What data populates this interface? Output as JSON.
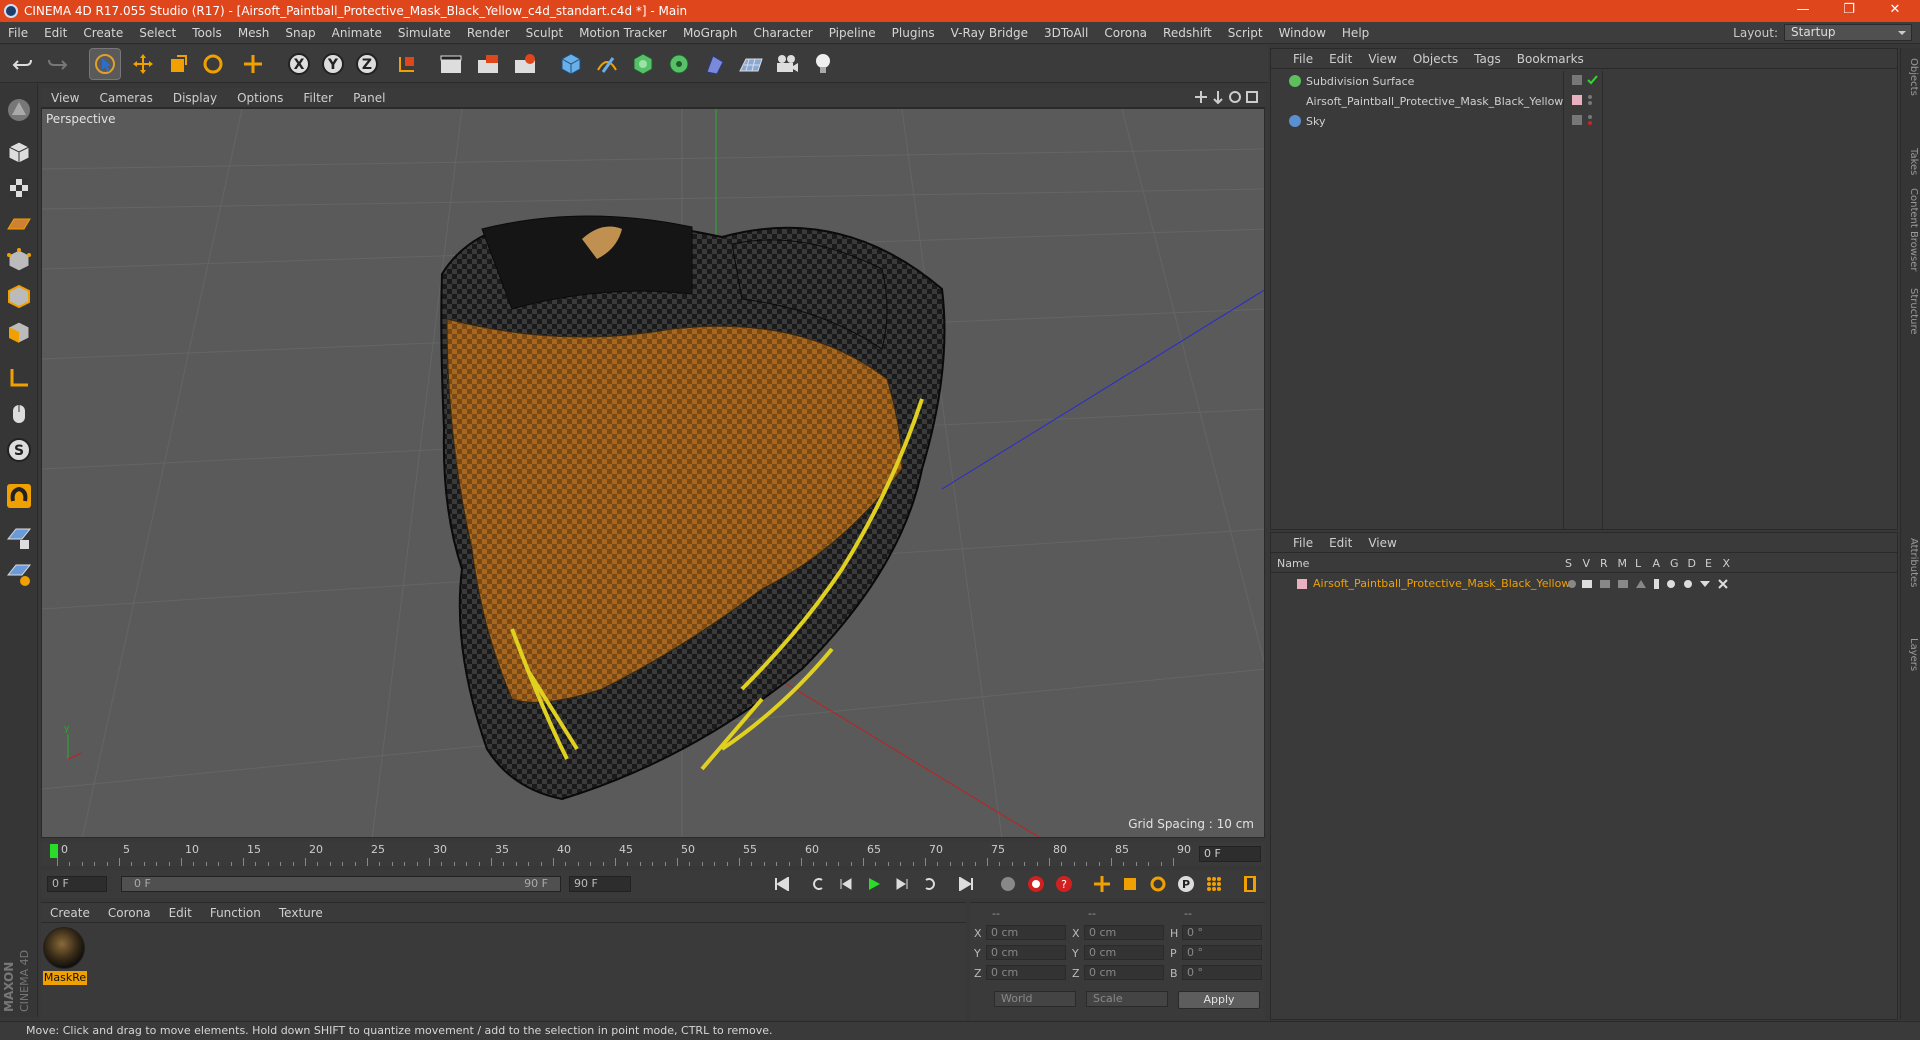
{
  "window": {
    "title": "CINEMA 4D R17.055 Studio (R17) - [Airsoft_Paintball_Protective_Mask_Black_Yellow_c4d_standart.c4d *] - Main",
    "controls": [
      "—",
      "❐",
      "✕"
    ]
  },
  "menubar": {
    "items": [
      "File",
      "Edit",
      "Create",
      "Select",
      "Tools",
      "Mesh",
      "Snap",
      "Animate",
      "Simulate",
      "Render",
      "Sculpt",
      "Motion Tracker",
      "MoGraph",
      "Character",
      "Pipeline",
      "Plugins",
      "V-Ray Bridge",
      "3DToAll",
      "Corona",
      "Redshift",
      "Script",
      "Window",
      "Help"
    ],
    "layout_label": "Layout:",
    "layout_value": "Startup"
  },
  "viewport": {
    "menu": [
      "View",
      "Cameras",
      "Display",
      "Options",
      "Filter",
      "Panel"
    ],
    "label": "Perspective",
    "grid_spacing": "Grid Spacing : 10 cm"
  },
  "timeline": {
    "ticks": [
      "0",
      "5",
      "10",
      "15",
      "20",
      "25",
      "30",
      "35",
      "40",
      "45",
      "50",
      "55",
      "60",
      "65",
      "70",
      "75",
      "80",
      "85",
      "90"
    ],
    "current_frame": "0 F"
  },
  "transport": {
    "start": "0 F",
    "range_start": "0 F",
    "range_end": "90 F",
    "end": "90 F"
  },
  "material_manager": {
    "menu": [
      "Create",
      "Corona",
      "Edit",
      "Function",
      "Texture"
    ],
    "material_name": "MaskRe"
  },
  "coordinates": {
    "headers": [
      "--",
      "--",
      "--"
    ],
    "rows": [
      {
        "a": "X",
        "av": "0 cm",
        "b": "X",
        "bv": "0 cm",
        "c": "H",
        "cv": "0 °"
      },
      {
        "a": "Y",
        "av": "0 cm",
        "b": "Y",
        "bv": "0 cm",
        "c": "P",
        "cv": "0 °"
      },
      {
        "a": "Z",
        "av": "0 cm",
        "b": "Z",
        "bv": "0 cm",
        "c": "B",
        "cv": "0 °"
      }
    ],
    "mode1": "World",
    "mode2": "Scale",
    "apply": "Apply"
  },
  "object_manager": {
    "menu": [
      "File",
      "Edit",
      "View",
      "Objects",
      "Tags",
      "Bookmarks"
    ],
    "objects": [
      {
        "name": "Subdivision Surface",
        "color": "#5fbf5f"
      },
      {
        "name": "Airsoft_Paintball_Protective_Mask_Black_Yellow",
        "color": "#b0b0b0"
      },
      {
        "name": "Sky",
        "color": "#5a8fd0"
      }
    ]
  },
  "layer_manager": {
    "menu": [
      "File",
      "Edit",
      "View"
    ],
    "col_name": "Name",
    "col_flags": [
      "S",
      "V",
      "R",
      "M",
      "L",
      "A",
      "G",
      "D",
      "E",
      "X"
    ],
    "layer_name": "Airsoft_Paintball_Protective_Mask_Black_Yellow"
  },
  "right_tabs": [
    "Objects",
    "Takes",
    "Content Browser",
    "Structure",
    "Attributes",
    "Layers"
  ],
  "brand": {
    "top": "MAXON",
    "bottom": "CINEMA 4D"
  },
  "status": "Move: Click and drag to move elements. Hold down SHIFT to quantize movement / add to the selection in point mode, CTRL to remove.",
  "colors": {
    "title_bar": "#e0461c",
    "accent": "#f0a000",
    "bg": "#383838"
  }
}
